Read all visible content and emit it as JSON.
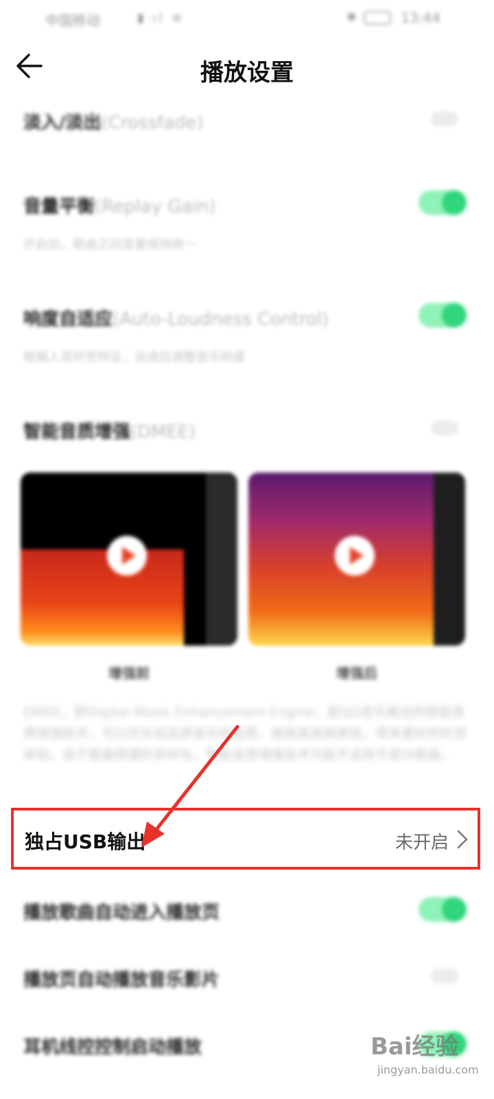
{
  "status_bar": {
    "carrier": "中国移动",
    "time": "13:44"
  },
  "header": {
    "title": "播放设置"
  },
  "settings": {
    "crossfade": {
      "title": "淡入/淡出",
      "title_en": "(Crossfade)",
      "enabled": false
    },
    "replay_gain": {
      "title": "音量平衡",
      "title_en": "(Replay Gain)",
      "desc": "开启后，歌曲之间音量保持统一",
      "enabled": true
    },
    "loudness": {
      "title": "响度自适应",
      "title_en": "(Auto-Loudness Control)",
      "desc": "根据人耳听觉特征，自适应调整音乐响度",
      "enabled": true
    },
    "dmee": {
      "title": "智能音质增强",
      "title_en": "(DMEE)",
      "enabled": false,
      "before_label": "增强前",
      "after_label": "增强后",
      "desc": "DMEE，即Digital Music Enhancement Engine，是QQ音乐推出的智能音质增强技术，可以优化低品质音乐的音质，提高其高频表现，带来更好的听觉体验。由于歌曲频谱的多样化，智能音质增强技术可能不适用于部分歌曲。"
    },
    "usb": {
      "title": "独占USB输出",
      "value": "未开启"
    },
    "auto_enter": {
      "title": "播放歌曲自动进入播放页",
      "enabled": true
    },
    "auto_mv": {
      "title": "播放页自动播放音乐影片",
      "enabled": false
    },
    "headset": {
      "title": "耳机线控控制启动播放",
      "enabled": true
    }
  },
  "watermark": {
    "brand": "Bai经验",
    "url": "jingyan.baidu.com"
  },
  "colors": {
    "accent": "#31d57b",
    "highlight": "#e8312a"
  }
}
